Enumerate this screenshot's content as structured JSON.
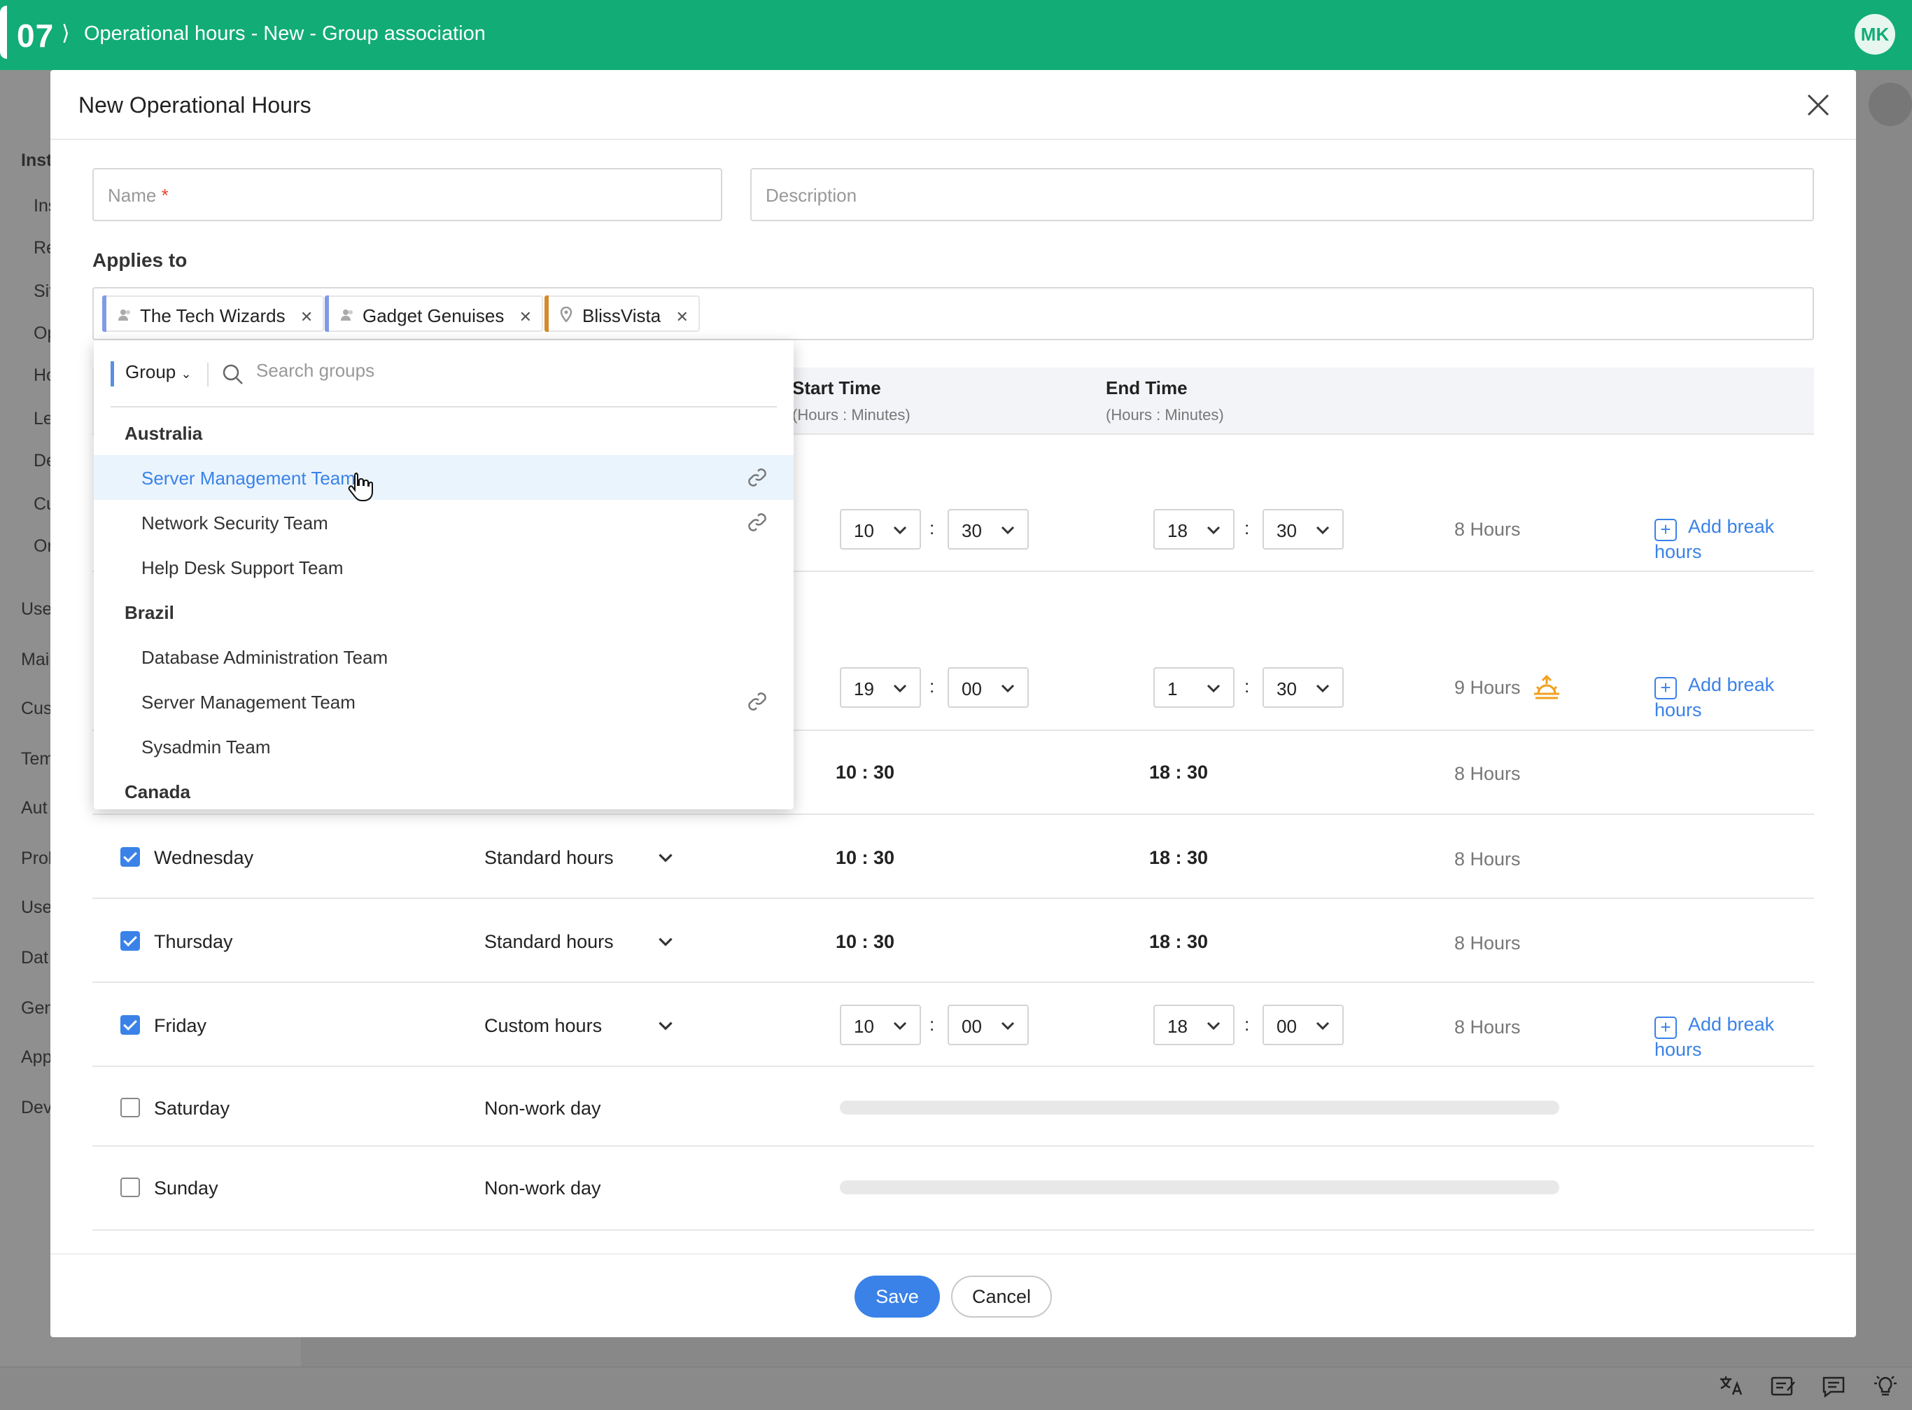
{
  "topbar": {
    "step": "07",
    "title": "Operational hours - New - Group association",
    "avatar": "MK"
  },
  "background": {
    "sidebar_items": [
      "Inst",
      "Ins",
      "Re",
      "Sit",
      "Op",
      "Ho",
      "Le",
      "De",
      "Cu",
      "Or",
      "Use",
      "Mai",
      "Cus",
      "Tem",
      "Aut",
      "Prol",
      "Use",
      "Dat",
      "Gen",
      "App",
      "Dev"
    ]
  },
  "modal": {
    "title": "New Operational Hours",
    "name_placeholder": "Name",
    "name_required": "*",
    "description_placeholder": "Description",
    "applies_to_label": "Applies to",
    "tags": [
      {
        "label": "The Tech Wizards",
        "icon": "group-icon",
        "color": "#7f9be8"
      },
      {
        "label": "Gadget Genuises",
        "icon": "group-icon",
        "color": "#7f9be8"
      },
      {
        "label": "BlissVista",
        "icon": "location-pin-icon",
        "color": "#d48a2a"
      }
    ]
  },
  "table": {
    "start_time_header": "Start Time",
    "start_time_sub": "(Hours : Minutes)",
    "end_time_header": "End Time",
    "end_time_sub": "(Hours : Minutes)",
    "colon": ":",
    "add_break": "Add break hours",
    "rows": [
      {
        "start_h": "10",
        "start_m": "30",
        "end_h": "18",
        "end_m": "30",
        "hours": "8 Hours"
      },
      {
        "start_h": "19",
        "start_m": "00",
        "end_h": "1",
        "end_m": "30",
        "hours": "9 Hours"
      },
      {
        "start": "10 : 30",
        "end": "18 : 30",
        "hours": "8 Hours"
      },
      {
        "day": "Wednesday",
        "type": "Standard hours",
        "start": "10 : 30",
        "end": "18 : 30",
        "hours": "8 Hours",
        "checked": true
      },
      {
        "day": "Thursday",
        "type": "Standard hours",
        "start": "10 : 30",
        "end": "18 : 30",
        "hours": "8 Hours",
        "checked": true
      },
      {
        "day": "Friday",
        "type": "Custom hours",
        "start_h": "10",
        "start_m": "00",
        "end_h": "18",
        "end_m": "00",
        "hours": "8 Hours",
        "checked": true
      },
      {
        "day": "Saturday",
        "type": "Non-work day",
        "checked": false
      },
      {
        "day": "Sunday",
        "type": "Non-work day",
        "checked": false
      }
    ]
  },
  "dropdown": {
    "filter": "Group",
    "search_placeholder": "Search groups",
    "groups": [
      {
        "country": "Australia",
        "items": [
          "Server Management Team",
          "Network Security Team",
          "Help Desk Support Team"
        ]
      },
      {
        "country": "Brazil",
        "items": [
          "Database Administration Team",
          "Server Management Team",
          "Sysadmin Team"
        ]
      },
      {
        "country": "Canada",
        "items": []
      }
    ]
  },
  "footer": {
    "save": "Save",
    "cancel": "Cancel"
  },
  "colors": {
    "brand": "#12ac77",
    "accent": "#3a82e8",
    "night_shift": "#f0a020"
  }
}
